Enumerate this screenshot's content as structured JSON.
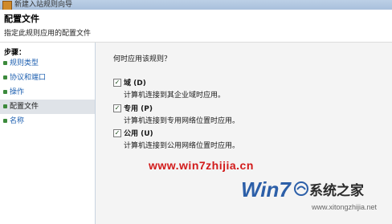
{
  "window": {
    "title": "新建入站规则向导"
  },
  "header": {
    "title": "配置文件",
    "subtitle": "指定此规则应用的配置文件"
  },
  "sidebar": {
    "title": "步骤：",
    "items": [
      {
        "label": "规则类型"
      },
      {
        "label": "协议和端口"
      },
      {
        "label": "操作"
      },
      {
        "label": "配置文件",
        "active": true
      },
      {
        "label": "名称"
      }
    ]
  },
  "main": {
    "question": "何时应用该规则？",
    "options": [
      {
        "name": "域 (D)",
        "description": "计算机连接到其企业域时应用。",
        "checked": true
      },
      {
        "name": "专用 (P)",
        "description": "计算机连接到专用网络位置时应用。",
        "checked": true
      },
      {
        "name": "公用 (U)",
        "description": "计算机连接到公用网络位置时应用。",
        "checked": true
      }
    ]
  },
  "watermark": {
    "url_text": "www.win7zhijia.cn",
    "logo_text": "Win7",
    "site_name": "系统之家",
    "site_url": "www.xitongzhijia.net"
  },
  "colors": {
    "link": "#1d5fb0",
    "bullet": "#3c8a3c",
    "watermark_red": "#d21a1a",
    "logo_blue": "#2c5fa8"
  }
}
